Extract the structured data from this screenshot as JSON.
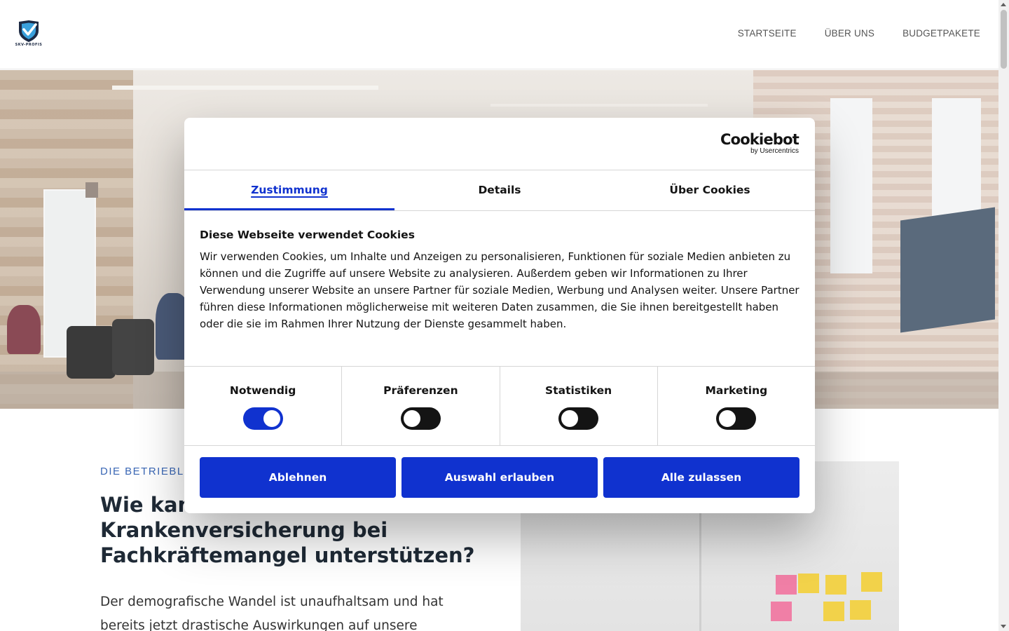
{
  "site": {
    "logo_text": "SKV-PROFIS",
    "nav": [
      "STARTSEITE",
      "ÜBER UNS",
      "BUDGETPAKETE"
    ]
  },
  "content": {
    "eyebrow": "DIE BETRIEBL",
    "headline_line1": "Wie kan",
    "headline_line2": "Krankenversicherung bei",
    "headline_line3": "Fachkräftemangel unterstützen?",
    "paragraph_line1": "Der demografische Wandel ist unaufhaltsam und hat",
    "paragraph_line2": "bereits jetzt drastische Auswirkungen auf unsere"
  },
  "cookie_dialog": {
    "brand": "Cookiebot",
    "brand_sub": "by Usercentrics",
    "tabs": [
      "Zustimmung",
      "Details",
      "Über Cookies"
    ],
    "active_tab": "Zustimmung",
    "title": "Diese Webseite verwendet Cookies",
    "body": "Wir verwenden Cookies, um Inhalte und Anzeigen zu personalisieren, Funktionen für soziale Medien anbieten zu können und die Zugriffe auf unsere Website zu analysieren. Außerdem geben wir Informationen zu Ihrer Verwendung unserer Website an unsere Partner für soziale Medien, Werbung und Analysen weiter. Unsere Partner führen diese Informationen möglicherweise mit weiteren Daten zusammen, die Sie ihnen bereitgestellt haben oder die sie im Rahmen Ihrer Nutzung der Dienste gesammelt haben.",
    "toggles": [
      {
        "label": "Notwendig",
        "on": true
      },
      {
        "label": "Präferenzen",
        "on": false
      },
      {
        "label": "Statistiken",
        "on": false
      },
      {
        "label": "Marketing",
        "on": false
      }
    ],
    "buttons": {
      "decline": "Ablehnen",
      "allow_selection": "Auswahl erlauben",
      "allow_all": "Alle zulassen"
    },
    "accent_color": "#1032cf"
  }
}
